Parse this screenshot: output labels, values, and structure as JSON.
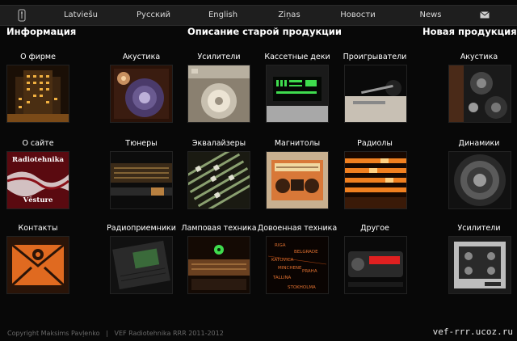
{
  "nav": {
    "tabs": [
      {
        "label": "Latviešu"
      },
      {
        "label": "Русский"
      },
      {
        "label": "English"
      },
      {
        "label": "Ziņas"
      },
      {
        "label": "Новости"
      },
      {
        "label": "News"
      }
    ],
    "logo_icon": "radio-tower-icon",
    "mail_icon": "mail-icon"
  },
  "sections": {
    "info": "Информация",
    "old": "Описание старой продукции",
    "new": "Новая продукция"
  },
  "tiles": [
    {
      "label": "О фирме",
      "thumb": "building-night-photo"
    },
    {
      "label": "Акустика",
      "thumb": "speaker-photo"
    },
    {
      "label": "Усилители",
      "thumb": "amplifier-knob-photo"
    },
    {
      "label": "Кассетные деки",
      "thumb": "cassette-deck-display-photo"
    },
    {
      "label": "Проигрыватели",
      "thumb": "turntable-photo"
    },
    {
      "label": "Акустика",
      "thumb": "new-speaker-photo"
    },
    {
      "label": "О сайте",
      "thumb": "radiotehnika-vesture-banner",
      "banner_text": {
        "top": "Radiotehnika",
        "bottom": "Vēsture"
      }
    },
    {
      "label": "Тюнеры",
      "thumb": "tuner-photo"
    },
    {
      "label": "Эквалайзеры",
      "thumb": "equalizer-sliders-photo"
    },
    {
      "label": "Магнитолы",
      "thumb": "radio-cassette-photo"
    },
    {
      "label": "Радиолы",
      "thumb": "radiogram-scale-photo"
    },
    {
      "label": "Динамики",
      "thumb": "woofer-photo"
    },
    {
      "label": "Контакты",
      "thumb": "envelope-at-icon"
    },
    {
      "label": "Радиоприемники",
      "thumb": "radio-receiver-photo"
    },
    {
      "label": "Ламповая техника",
      "thumb": "tube-radio-photo"
    },
    {
      "label": "Довоенная техника",
      "thumb": "prewar-dial-photo",
      "dial_text": [
        "RIGA",
        "BELGRADE",
        "KATOVICA",
        "MINCHENE",
        "TALLINA",
        "PRAHA",
        "STOKHOLMA"
      ]
    },
    {
      "label": "Другое",
      "thumb": "red-device-photo"
    },
    {
      "label": "Усилители",
      "thumb": "new-amplifier-photo"
    }
  ],
  "footer": {
    "copyright": "Copyright Maksims Pavļenko   |   VEF Radiotehnika RRR 2011-2012",
    "site": "vef-rrr.ucoz.ru"
  },
  "colors": {
    "nav_bg": "#1e1e1e",
    "page_bg": "#080808",
    "accent_orange": "#e06a20",
    "accent_green": "#3fdc4e"
  }
}
